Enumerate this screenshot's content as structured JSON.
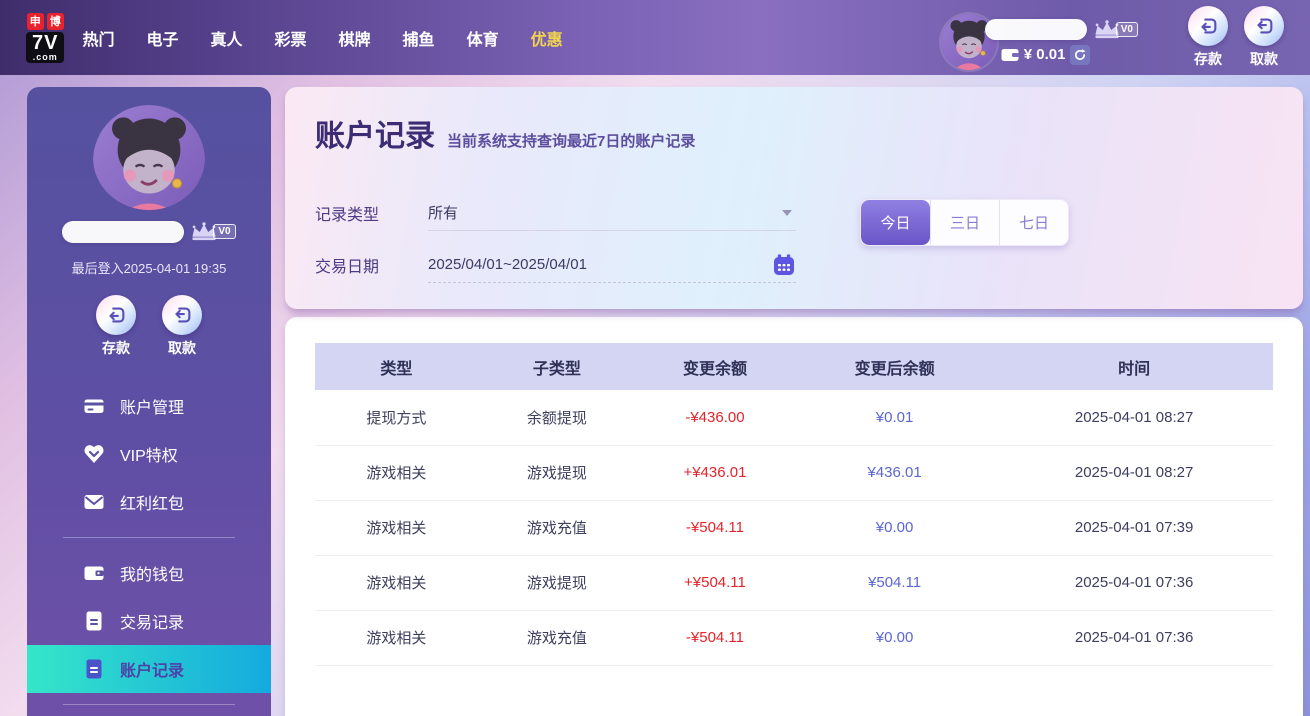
{
  "topnav": {
    "logo": {
      "badge_left": "申",
      "badge_right": "博",
      "main": "7V",
      "suffix": ".com"
    },
    "items": [
      {
        "label": "热门"
      },
      {
        "label": "电子"
      },
      {
        "label": "真人"
      },
      {
        "label": "彩票"
      },
      {
        "label": "棋牌"
      },
      {
        "label": "捕鱼"
      },
      {
        "label": "体育"
      },
      {
        "label": "优惠"
      }
    ],
    "user": {
      "vip_badge": "V0",
      "balance": "¥ 0.01"
    },
    "deposit_label": "存款",
    "withdraw_label": "取款"
  },
  "sidebar": {
    "vip_badge": "V0",
    "last_login": "最后登入2025-04-01 19:35",
    "deposit_label": "存款",
    "withdraw_label": "取款",
    "menu": [
      {
        "label": "账户管理",
        "icon": "bank-card-icon"
      },
      {
        "label": "VIP特权",
        "icon": "vip-heart-icon"
      },
      {
        "label": "红利红包",
        "icon": "envelope-icon"
      },
      {
        "label": "我的钱包",
        "icon": "wallet-icon"
      },
      {
        "label": "交易记录",
        "icon": "document-icon"
      },
      {
        "label": "账户记录",
        "icon": "document-icon",
        "active": true
      }
    ]
  },
  "main": {
    "title": "账户记录",
    "subtitle": "当前系统支持查询最近7日的账户记录",
    "filters": {
      "type_label": "记录类型",
      "type_value": "所有",
      "date_label": "交易日期",
      "date_value": "2025/04/01~2025/04/01",
      "quick_buttons": [
        {
          "label": "今日",
          "active": true
        },
        {
          "label": "三日",
          "active": false
        },
        {
          "label": "七日",
          "active": false
        }
      ]
    },
    "table": {
      "headers": [
        "类型",
        "子类型",
        "变更余额",
        "变更后余额",
        "时间"
      ],
      "rows": [
        {
          "type": "提现方式",
          "subtype": "余额提现",
          "change": "-¥436.00",
          "after": "¥0.01",
          "time": "2025-04-01 08:27"
        },
        {
          "type": "游戏相关",
          "subtype": "游戏提现",
          "change": "+¥436.01",
          "after": "¥436.01",
          "time": "2025-04-01 08:27"
        },
        {
          "type": "游戏相关",
          "subtype": "游戏充值",
          "change": "-¥504.11",
          "after": "¥0.00",
          "time": "2025-04-01 07:39"
        },
        {
          "type": "游戏相关",
          "subtype": "游戏提现",
          "change": "+¥504.11",
          "after": "¥504.11",
          "time": "2025-04-01 07:36"
        },
        {
          "type": "游戏相关",
          "subtype": "游戏充值",
          "change": "-¥504.11",
          "after": "¥0.00",
          "time": "2025-04-01 07:36"
        }
      ]
    }
  },
  "colors": {
    "topbar_purple": "#54408a",
    "sidebar_purple": "#5e4fa4",
    "active_menu_gradient_start": "#35e6c9",
    "active_menu_gradient_end": "#14aade",
    "accent_purple": "#6a55c8",
    "negative_red": "#e5232a",
    "after_balance_blue": "#5b66d4",
    "promo_yellow": "#f3d44e"
  }
}
